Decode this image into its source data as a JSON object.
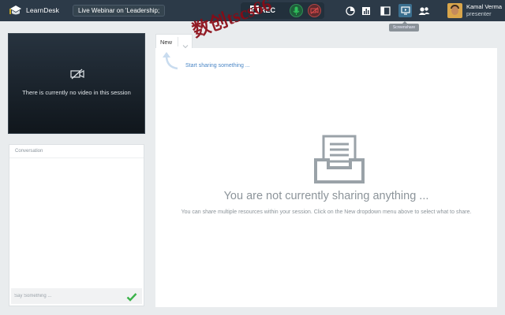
{
  "app": {
    "name": "LearnDesk"
  },
  "session": {
    "title": "Live Webinar on 'Leadership;"
  },
  "toolbar": {
    "rec_label": "REC",
    "tooltip": "Screenshare"
  },
  "user": {
    "name": "Kamal Verma",
    "role": "presenter"
  },
  "video": {
    "no_video_text": "There is currently no video in this session"
  },
  "conversation": {
    "title": "Conversation",
    "input_placeholder": "Say Something ..."
  },
  "main": {
    "tab_label": "New",
    "hint_text": "Start sharing something ...",
    "empty_title": "You are not currently sharing anything ...",
    "empty_subtitle": "You can share multiple resources within your session. Click on the New dropdown menu above to select what to share."
  },
  "watermark": {
    "text": "数创tscs66"
  },
  "colors": {
    "topbar": "#2c3a48",
    "accent_link": "#4a86c6",
    "mic_green": "#2fbf5a",
    "cam_red": "#d94b4b",
    "send_green": "#3cb34a",
    "watermark": "#8b0a14"
  }
}
